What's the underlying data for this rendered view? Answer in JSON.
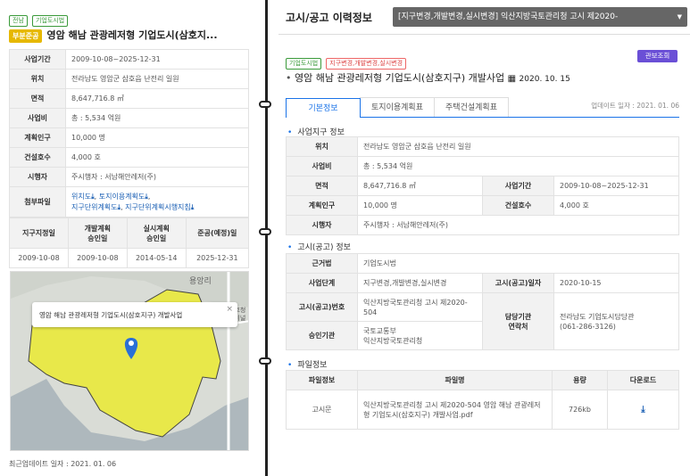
{
  "left": {
    "tags": [
      "전남",
      "기업도시법"
    ],
    "status": "부분준공",
    "title": "영암 해남 관광레저형 기업도시(삼호지...",
    "info_rows": [
      {
        "label": "사업기간",
        "value": "2009-10-08~2025-12-31"
      },
      {
        "label": "위치",
        "value": "전라남도 영암군 삼호읍 난전리 일원"
      },
      {
        "label": "면적",
        "value": "8,647,716.8 ㎡"
      },
      {
        "label": "사업비",
        "value": "총 : 5,534 억원"
      },
      {
        "label": "계획인구",
        "value": "10,000 명"
      },
      {
        "label": "건설호수",
        "value": "4,000 호"
      },
      {
        "label": "시행자",
        "value": "주시행자 : 서남해안레저(주)"
      }
    ],
    "attach_label": "첨부파일",
    "attach_links": [
      "위치도",
      "토지이용계획도",
      "지구단위계획도",
      "지구단위계획시행지침"
    ],
    "date_headers": [
      "지구지정일",
      "개발계획\n승인일",
      "실시계획\n승인일",
      "준공(예정)일"
    ],
    "date_values": [
      "2009-10-08",
      "2009-10-08",
      "2014-05-14",
      "2025-12-31"
    ],
    "map_popup": "영암 해남 관광레저형 기업도시(삼호지구) 개발사업",
    "map_labels": [
      "용앙리",
      "서호청\n터미널"
    ],
    "updated": "최근업데이트 일자 : 2021. 01. 06"
  },
  "right": {
    "header_title": "고시/공고 이력정보",
    "select_value": "[지구변경,개발변경,실시변경] 익산지방국토관리청 고시 제2020-",
    "tags": [
      "기업도시법",
      "지구변경,개발변경,실시변경"
    ],
    "gazette_button": "관보조회",
    "title": "영암 해남 관광레저형 기업도시(삼호지구) 개발사업",
    "date": "2020. 10. 15",
    "tabs": [
      "기본정보",
      "토지이용계획표",
      "주택건설계획표"
    ],
    "update_date": "업데이트 일자 : 2021. 01. 06",
    "sec1": "사업지구 정보",
    "sec1_rows": {
      "loc_label": "위치",
      "loc": "전라남도 영암군 삼호읍 난전리 일원",
      "cost_label": "사업비",
      "cost": "총 : 5,534 억원",
      "area_label": "면적",
      "area": "8,647,716.8 ㎡",
      "period_label": "사업기간",
      "period": "2009-10-08~2025-12-31",
      "pop_label": "계획인구",
      "pop": "10,000 명",
      "house_label": "건설호수",
      "house": "4,000 호",
      "exec_label": "시행자",
      "exec": "주시행자 : 서남해안레저(주)"
    },
    "sec2": "고시(공고) 정보",
    "sec2_rows": {
      "law_label": "근거법",
      "law": "기업도시법",
      "stage_label": "사업단계",
      "stage": "지구변경,개발변경,실시변경",
      "gdate_label": "고시(공고)일자",
      "gdate": "2020-10-15",
      "gno_label": "고시(공고)번호",
      "gno": "익산지방국토관리청 고시 제2020-504",
      "contact_label": "담당기관\n연락처",
      "contact": "전라남도 기업도시담당관\n(061-286-3126)",
      "appr_label": "승인기관",
      "appr": "국토교통부\n익산지방국토관리청"
    },
    "sec3": "파일정보",
    "file_headers": [
      "파일정보",
      "파일명",
      "용량",
      "다운로드"
    ],
    "file_row": {
      "type": "고시문",
      "name": "익산지방국토관리청 고시 제2020-504 영암 해남 관광레저형 기업도시(삼호지구) 개발사업.pdf",
      "size": "726kb"
    }
  },
  "colors": {
    "accent": "#1a73e8",
    "status": "#e6b800",
    "map_yellow": "#e8e84a",
    "header_bg": "#222222"
  }
}
